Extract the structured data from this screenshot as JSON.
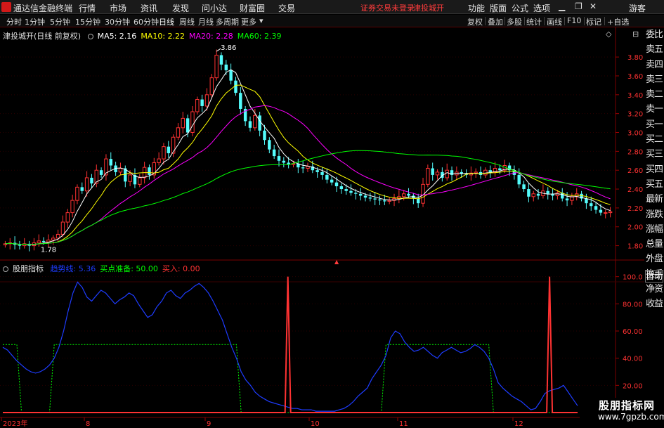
{
  "app": {
    "title": "通达信金融终端",
    "menus": [
      "行情",
      "市场",
      "资讯",
      "发现",
      "问小达",
      "财富圈",
      "交易"
    ],
    "login_warning": "证券交易未登录",
    "stock_tab": "津投城开",
    "right_menus": [
      "功能",
      "版面",
      "公式",
      "选项"
    ],
    "guest": "游客"
  },
  "toolbar": {
    "periods": [
      "分时",
      "1分钟",
      "5分钟",
      "15分钟",
      "30分钟",
      "60分钟",
      "日线",
      "周线",
      "月线",
      "多周期",
      "更多"
    ],
    "active_period": "日线",
    "right_buttons": [
      "复权",
      "叠加",
      "多股",
      "统计",
      "画线",
      "F10",
      "标记",
      "+自选"
    ]
  },
  "main_chart": {
    "stock_label": "津投城开",
    "adjust_label": "(日线 前复权)",
    "ma_legend": [
      {
        "label": "MA5: 2.16",
        "color": "#ffffff"
      },
      {
        "label": "MA10: 2.22",
        "color": "#ffff00"
      },
      {
        "label": "MA20: 2.28",
        "color": "#ff00ff"
      },
      {
        "label": "MA60: 2.39",
        "color": "#00ff00"
      }
    ],
    "high_label": "3.86",
    "low_label": "1.78",
    "y_ticks": [
      "3.80",
      "3.60",
      "3.40",
      "3.20",
      "3.00",
      "2.80",
      "2.60",
      "2.40",
      "2.20",
      "2.00",
      "1.80"
    ],
    "colors": {
      "up": "#ff3232",
      "down": "#54fcfc"
    }
  },
  "indicator": {
    "name": "股朋指标",
    "legend": [
      {
        "label": "趋势线: 5.36",
        "color": "#1e3cff"
      },
      {
        "label": "买点准备: 50.00",
        "color": "#00ff00"
      },
      {
        "label": "买入: 0.00",
        "color": "#ff3232"
      }
    ],
    "y_ticks": [
      "100.0",
      "80.00",
      "60.00",
      "40.00",
      "20.00"
    ]
  },
  "x_axis": [
    "2023年",
    "8",
    "9",
    "10",
    "11",
    "12"
  ],
  "side_panel": [
    "委比",
    "卖五",
    "卖四",
    "卖三",
    "卖二",
    "卖一",
    "买一",
    "买二",
    "买三",
    "买四",
    "买五",
    "最新",
    "涨跌",
    "涨幅",
    "总量",
    "外盘",
    "换手",
    "净资",
    "收益"
  ],
  "auto_button": "自动",
  "watermark": {
    "line1": "股朋指标网",
    "line2": "www.7gpzb.com"
  },
  "chart_data": [
    {
      "type": "candlestick",
      "title": "津投城开 (日线 前复权)",
      "x": [
        "2023年",
        "8",
        "9",
        "10",
        "11",
        "12"
      ],
      "ylim": [
        1.7,
        3.95
      ],
      "close_series": [
        1.82,
        1.83,
        1.81,
        1.8,
        1.82,
        1.8,
        1.83,
        1.85,
        1.84,
        1.86,
        1.88,
        1.92,
        2.05,
        2.15,
        2.28,
        2.42,
        2.38,
        2.52,
        2.46,
        2.6,
        2.55,
        2.72,
        2.65,
        2.58,
        2.62,
        2.48,
        2.55,
        2.45,
        2.52,
        2.63,
        2.55,
        2.68,
        2.72,
        2.85,
        2.78,
        2.95,
        3.05,
        3.15,
        3.0,
        3.22,
        3.35,
        3.28,
        3.4,
        3.58,
        3.82,
        3.72,
        3.66,
        3.55,
        3.42,
        3.25,
        3.12,
        3.05,
        3.18,
        3.02,
        2.92,
        2.82,
        2.75,
        2.7,
        2.68,
        2.66,
        2.67,
        2.63,
        2.62,
        2.64,
        2.6,
        2.58,
        2.55,
        2.5,
        2.47,
        2.43,
        2.4,
        2.38,
        2.36,
        2.35,
        2.33,
        2.31,
        2.3,
        2.29,
        2.28,
        2.27,
        2.28,
        2.3,
        2.32,
        2.35,
        2.33,
        2.3,
        2.25,
        2.45,
        2.62,
        2.55,
        2.58,
        2.52,
        2.6,
        2.55,
        2.58,
        2.56,
        2.55,
        2.57,
        2.58,
        2.55,
        2.6,
        2.58,
        2.62,
        2.6,
        2.65,
        2.6,
        2.55,
        2.45,
        2.4,
        2.32,
        2.35,
        2.33,
        2.38,
        2.35,
        2.33,
        2.36,
        2.3,
        2.28,
        2.32,
        2.35,
        2.3,
        2.25,
        2.22,
        2.18,
        2.15,
        2.15,
        2.16
      ],
      "series": [
        {
          "name": "MA5",
          "last": 2.16,
          "color": "#ffffff"
        },
        {
          "name": "MA10",
          "last": 2.22,
          "color": "#ffff00"
        },
        {
          "name": "MA20",
          "last": 2.28,
          "color": "#ff00ff"
        },
        {
          "name": "MA60",
          "last": 2.39,
          "color": "#00ff00"
        }
      ],
      "annotations": {
        "high": 3.86,
        "low": 1.78
      }
    },
    {
      "type": "line",
      "title": "股朋指标",
      "ylim": [
        0,
        105
      ],
      "x": [
        "2023年",
        "8",
        "9",
        "10",
        "11",
        "12"
      ],
      "series": [
        {
          "name": "趋势线",
          "last": 5.36,
          "color": "#1e3cff",
          "values": [
            48,
            46,
            42,
            38,
            35,
            32,
            30,
            29,
            30,
            32,
            35,
            40,
            48,
            60,
            75,
            88,
            96,
            92,
            85,
            82,
            86,
            90,
            88,
            84,
            80,
            83,
            85,
            88,
            86,
            80,
            75,
            70,
            72,
            78,
            82,
            88,
            90,
            86,
            84,
            88,
            90,
            93,
            95,
            92,
            88,
            82,
            75,
            68,
            58,
            48,
            40,
            30,
            24,
            20,
            15,
            12,
            10,
            8,
            7,
            6,
            5,
            4,
            3,
            3,
            2,
            2,
            2,
            1,
            1,
            1,
            1,
            1,
            2,
            3,
            5,
            8,
            12,
            15,
            18,
            25,
            30,
            35,
            42,
            55,
            60,
            58,
            52,
            48,
            45,
            46,
            48,
            45,
            42,
            40,
            44,
            46,
            48,
            46,
            44,
            45,
            47,
            50,
            48,
            45,
            40,
            32,
            22,
            18,
            15,
            12,
            10,
            8,
            5,
            2,
            3,
            8,
            14,
            16,
            17,
            18,
            20,
            15,
            10,
            5
          ]
        },
        {
          "name": "买点准备",
          "last": 50.0,
          "color": "#00ff00"
        },
        {
          "name": "买入",
          "last": 0.0,
          "color": "#ff3232",
          "spikes": [
            {
              "x_index": 62,
              "value": 100
            },
            {
              "x_index": 120,
              "value": 100
            }
          ]
        }
      ]
    }
  ]
}
